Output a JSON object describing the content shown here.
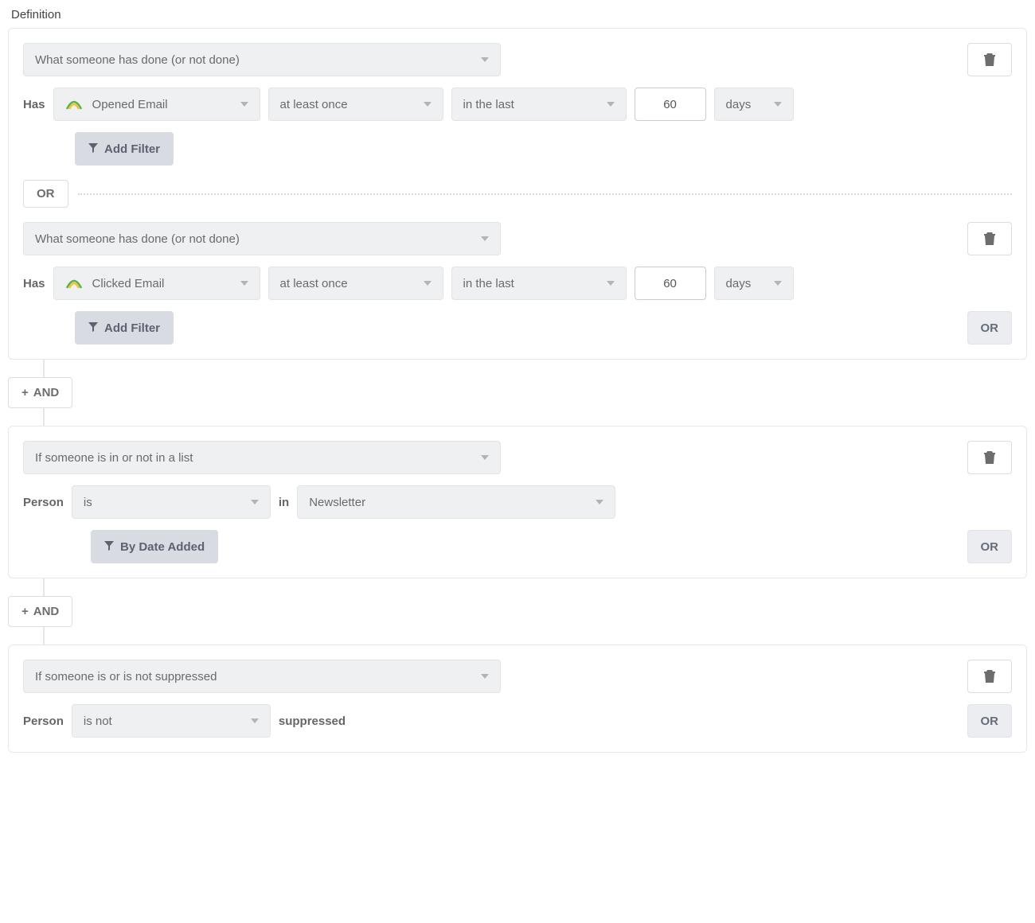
{
  "title": "Definition",
  "common": {
    "or": "OR",
    "and": "AND",
    "addFilter": "Add Filter",
    "byDateAdded": "By Date Added"
  },
  "group1": {
    "cond1": {
      "type": "What someone has done (or not done)",
      "prefix": "Has",
      "metric": "Opened Email",
      "freq": "at least once",
      "range": "in the last",
      "value": "60",
      "unit": "days"
    },
    "cond2": {
      "type": "What someone has done (or not done)",
      "prefix": "Has",
      "metric": "Clicked Email",
      "freq": "at least once",
      "range": "in the last",
      "value": "60",
      "unit": "days"
    }
  },
  "group2": {
    "type": "If someone is in or not in a list",
    "subject": "Person",
    "op": "is",
    "prep": "in",
    "list": "Newsletter"
  },
  "group3": {
    "type": "If someone is or is not suppressed",
    "subject": "Person",
    "op": "is not",
    "state": "suppressed"
  }
}
